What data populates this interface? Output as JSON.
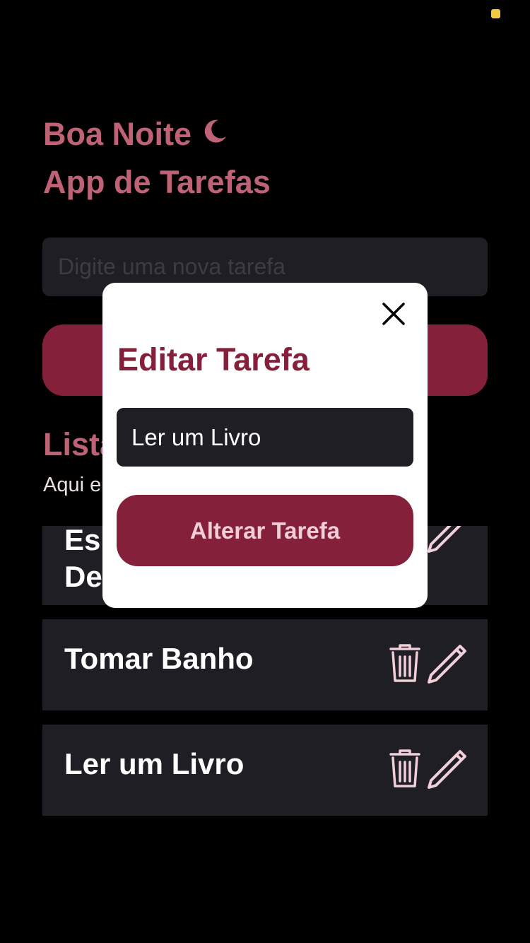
{
  "header": {
    "greeting": "Boa Noite",
    "greeting_icon": "moon-icon",
    "app_title": "App de Tarefas"
  },
  "new_task": {
    "placeholder": "Digite uma nova tarefa"
  },
  "list": {
    "title": "Lista",
    "subtitle": "Aqui e"
  },
  "tasks": [
    {
      "name": "Es\nDe"
    },
    {
      "name": "Tomar Banho"
    },
    {
      "name": "Ler um Livro"
    }
  ],
  "icons": {
    "delete": "trash-icon",
    "edit": "pencil-icon",
    "close": "close-icon"
  },
  "modal": {
    "title": "Editar Tarefa",
    "input_value": "Ler um Livro",
    "save_label": "Alterar Tarefa"
  },
  "colors": {
    "accent_text": "#c06276",
    "button": "#85203a",
    "card": "#1f1e24",
    "icon": "#f0cfd8"
  }
}
